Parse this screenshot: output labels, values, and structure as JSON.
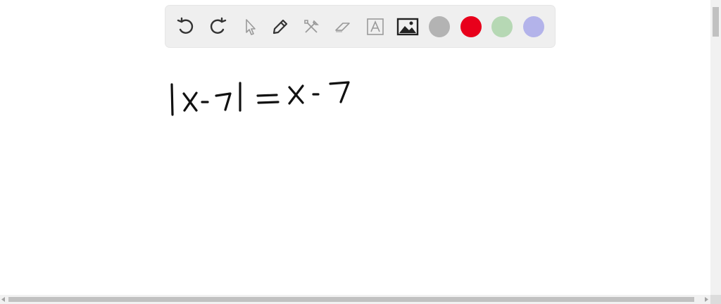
{
  "toolbar": {
    "tools": [
      {
        "icon": "undo-icon"
      },
      {
        "icon": "redo-icon"
      },
      {
        "icon": "select-pointer-icon"
      },
      {
        "icon": "pencil-icon"
      },
      {
        "icon": "tools-icon"
      },
      {
        "icon": "eraser-icon"
      },
      {
        "icon": "text-box-icon"
      },
      {
        "icon": "image-icon"
      }
    ],
    "colors": [
      "#b3b3b3",
      "#e8001b",
      "#b6d8b4",
      "#b3b3ea"
    ]
  },
  "canvas": {
    "handwriting": "|x-7| = x-7"
  }
}
